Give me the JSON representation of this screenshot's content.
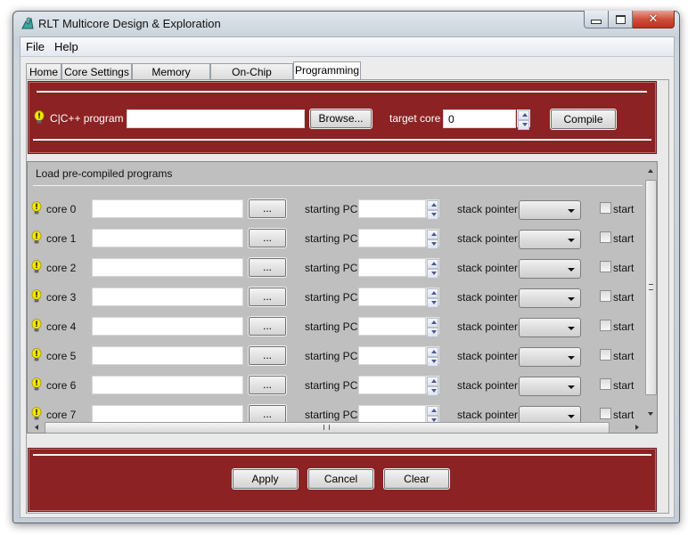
{
  "window": {
    "title": "RLT Multicore Design & Exploration",
    "icon": "app-logo-icon",
    "controls": [
      "minimize-icon",
      "maximize-icon",
      "close-icon"
    ]
  },
  "menubar": {
    "items": [
      {
        "label": "File"
      },
      {
        "label": "Help"
      }
    ]
  },
  "tabs": [
    {
      "label": "Home",
      "active": false
    },
    {
      "label": "Core Settings",
      "active": false
    },
    {
      "label": "Memory System",
      "active": false
    },
    {
      "label": "On-Chip Network",
      "active": false
    },
    {
      "label": "Programming",
      "active": true
    }
  ],
  "compile_panel": {
    "program_label": "C|C++ program",
    "program_value": "",
    "browse_label": "Browse...",
    "target_core_label": "target core",
    "target_core_value": "0",
    "compile_label": "Compile",
    "hint_icon": "lightbulb-icon"
  },
  "precompiled": {
    "section_title": "Load pre-compiled programs",
    "browse_label": "...",
    "starting_pc_label": "starting PC",
    "stack_pointer_label": "stack pointer",
    "start_label": "start",
    "cores": [
      {
        "label": "core 0",
        "program": "",
        "starting_pc": "",
        "stack_pointer": "",
        "start": false
      },
      {
        "label": "core 1",
        "program": "",
        "starting_pc": "",
        "stack_pointer": "",
        "start": false
      },
      {
        "label": "core 2",
        "program": "",
        "starting_pc": "",
        "stack_pointer": "",
        "start": false
      },
      {
        "label": "core 3",
        "program": "",
        "starting_pc": "",
        "stack_pointer": "",
        "start": false
      },
      {
        "label": "core 4",
        "program": "",
        "starting_pc": "",
        "stack_pointer": "",
        "start": false
      },
      {
        "label": "core 5",
        "program": "",
        "starting_pc": "",
        "stack_pointer": "",
        "start": false
      },
      {
        "label": "core 6",
        "program": "",
        "starting_pc": "",
        "stack_pointer": "",
        "start": false
      },
      {
        "label": "core 7",
        "program": "",
        "starting_pc": "",
        "stack_pointer": "",
        "start": false
      }
    ]
  },
  "footer": {
    "apply_label": "Apply",
    "cancel_label": "Cancel",
    "clear_label": "Clear"
  },
  "colors": {
    "panel_red": "#8c2223",
    "content_gray": "#bfbfbf",
    "hint_yellow": "#f2e600"
  }
}
